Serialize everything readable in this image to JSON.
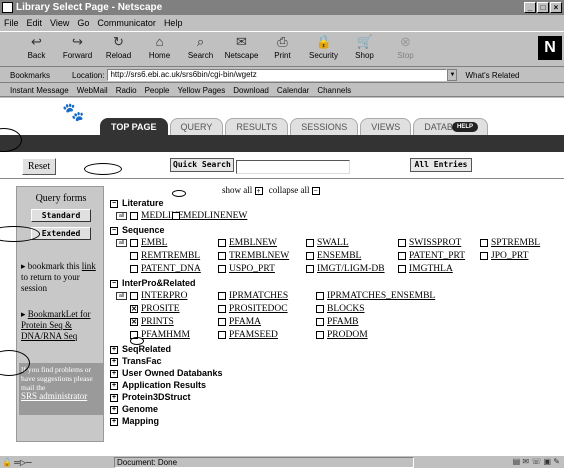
{
  "window": {
    "title": "Library Select Page - Netscape",
    "buttons": [
      "_",
      "□",
      "×"
    ]
  },
  "menu": [
    "File",
    "Edit",
    "View",
    "Go",
    "Communicator",
    "Help"
  ],
  "toolbar": [
    {
      "label": "Back",
      "icon": "back-arrow-icon",
      "glyph": "↩"
    },
    {
      "label": "Forward",
      "icon": "forward-arrow-icon",
      "glyph": "↪"
    },
    {
      "label": "Reload",
      "icon": "reload-icon",
      "glyph": "↻"
    },
    {
      "label": "Home",
      "icon": "home-icon",
      "glyph": "⌂"
    },
    {
      "label": "Search",
      "icon": "search-icon",
      "glyph": "⌕"
    },
    {
      "label": "Netscape",
      "icon": "netscape-icon",
      "glyph": "✉"
    },
    {
      "label": "Print",
      "icon": "print-icon",
      "glyph": "⎙"
    },
    {
      "label": "Security",
      "icon": "lock-icon",
      "glyph": "🔒"
    },
    {
      "label": "Shop",
      "icon": "shop-icon",
      "glyph": "🛒"
    },
    {
      "label": "Stop",
      "icon": "stop-icon",
      "glyph": "⊗",
      "disabled": true
    }
  ],
  "netscape_logo": "N",
  "location": {
    "bookmarks_label": "Bookmarks",
    "label": "Location:",
    "url": "http://srs6.ebi.ac.uk/srs6bin/cgi-bin/wgetz",
    "whats_related": "What's Related"
  },
  "personal_bar": [
    "Instant Message",
    "WebMail",
    "Radio",
    "People",
    "Yellow Pages",
    "Download",
    "Calendar",
    "Channels"
  ],
  "tabs": [
    {
      "label": "TOP PAGE",
      "active": true
    },
    {
      "label": "QUERY"
    },
    {
      "label": "RESULTS"
    },
    {
      "label": "SESSIONS"
    },
    {
      "label": "VIEWS"
    },
    {
      "label": "DATABANKS"
    }
  ],
  "help_label": "HELP",
  "reset_label": "Reset",
  "quick_search_label": "Quick Search",
  "quick_search_value": "",
  "all_entries_label": "All Entries",
  "sidebar": {
    "query_forms": "Query forms",
    "standard": "Standard",
    "extended": "Extended",
    "bookmark_pre": "▸ bookmark this",
    "bookmark_link": "link",
    "bookmark_post": "to return to your session",
    "bookmarklet_link": "BookmarkLet for Protein Seq & DNA/RNA Seq",
    "problems_text": "If you find problems or have suggestions please mail the",
    "admin_link": "SRS administrator"
  },
  "show_all": "show all",
  "collapse_all": "collapse all",
  "sections": [
    {
      "name": "Literature",
      "expanded": true,
      "items": [
        [
          "MEDLINE",
          "MEDLINENEW"
        ]
      ]
    },
    {
      "name": "Sequence",
      "expanded": true,
      "items": [
        [
          "EMBL",
          "EMBLNEW",
          "SWALL",
          "SWISSPROT",
          "SPTREMBL"
        ],
        [
          "REMTREMBL",
          "TREMBLNEW",
          "ENSEMBL",
          "PATENT_PRT",
          "JPO_PRT"
        ],
        [
          "PATENT_DNA",
          "USPO_PRT",
          "IMGT/LIGM-DB",
          "IMGTHLA"
        ]
      ]
    },
    {
      "name": "InterPro&Related",
      "expanded": true,
      "items": [
        [
          "INTERPRO",
          "IPRMATCHES",
          "IPRMATCHES_ENSEMBL"
        ],
        [
          "PROSITE",
          "PROSITEDOC",
          "BLOCKS"
        ],
        [
          "PRINTS",
          "PFAMA",
          "PFAMB"
        ],
        [
          "PFAMHMM",
          "PFAMSEED",
          "PRODOM"
        ]
      ]
    },
    {
      "name": "SeqRelated",
      "expanded": false
    },
    {
      "name": "TransFac",
      "expanded": false
    },
    {
      "name": "User Owned Databanks",
      "expanded": false
    },
    {
      "name": "Application Results",
      "expanded": false
    },
    {
      "name": "Protein3DStruct",
      "expanded": false
    },
    {
      "name": "Genome",
      "expanded": false
    },
    {
      "name": "Mapping",
      "expanded": false
    }
  ],
  "checked": [
    "PROSITE",
    "PRINTS"
  ],
  "status": "Document: Done"
}
